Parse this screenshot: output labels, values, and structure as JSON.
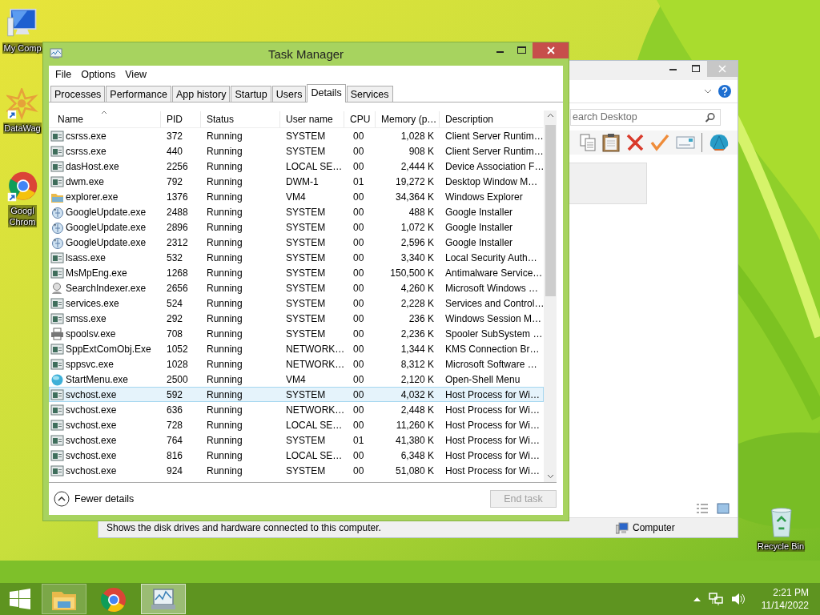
{
  "desktop_icons": [
    {
      "kind": "computer",
      "label": "My Comp"
    },
    {
      "kind": "datawag",
      "label": "DataWag"
    },
    {
      "kind": "chrome",
      "label": "Googl\nChrom"
    },
    {
      "kind": "recycle",
      "label": "Recycle Bin"
    }
  ],
  "explorer": {
    "search": {
      "placeholder": "earch Desktop"
    },
    "status_text": "Shows the disk drives and hardware connected to this computer.",
    "location": "Computer"
  },
  "task_manager": {
    "title": "Task Manager",
    "menu": [
      "File",
      "Options",
      "View"
    ],
    "tabs": [
      {
        "label": "Processes",
        "selected": false
      },
      {
        "label": "Performance",
        "selected": false
      },
      {
        "label": "App history",
        "selected": false
      },
      {
        "label": "Startup",
        "selected": false
      },
      {
        "label": "Users",
        "selected": false
      },
      {
        "label": "Details",
        "selected": true
      },
      {
        "label": "Services",
        "selected": false
      }
    ],
    "columns": [
      "Name",
      "PID",
      "Status",
      "User name",
      "CPU",
      "Memory (p…",
      "Description"
    ],
    "rows": [
      {
        "kind": "app",
        "name": "csrss.exe",
        "pid": "372",
        "status": "Running",
        "user": "SYSTEM",
        "cpu": "00",
        "memory": "1,028 K",
        "description": "Client Server Runtim…",
        "selected": false
      },
      {
        "kind": "app",
        "name": "csrss.exe",
        "pid": "440",
        "status": "Running",
        "user": "SYSTEM",
        "cpu": "00",
        "memory": "908 K",
        "description": "Client Server Runtim…",
        "selected": false
      },
      {
        "kind": "app",
        "name": "dasHost.exe",
        "pid": "2256",
        "status": "Running",
        "user": "LOCAL SE…",
        "cpu": "00",
        "memory": "2,444 K",
        "description": "Device Association F…",
        "selected": false
      },
      {
        "kind": "app",
        "name": "dwm.exe",
        "pid": "792",
        "status": "Running",
        "user": "DWM-1",
        "cpu": "01",
        "memory": "19,272 K",
        "description": "Desktop Window M…",
        "selected": false
      },
      {
        "kind": "folder",
        "name": "explorer.exe",
        "pid": "1376",
        "status": "Running",
        "user": "VM4",
        "cpu": "00",
        "memory": "34,364 K",
        "description": "Windows Explorer",
        "selected": false
      },
      {
        "kind": "update",
        "name": "GoogleUpdate.exe",
        "pid": "2488",
        "status": "Running",
        "user": "SYSTEM",
        "cpu": "00",
        "memory": "488 K",
        "description": "Google Installer",
        "selected": false
      },
      {
        "kind": "update",
        "name": "GoogleUpdate.exe",
        "pid": "2896",
        "status": "Running",
        "user": "SYSTEM",
        "cpu": "00",
        "memory": "1,072 K",
        "description": "Google Installer",
        "selected": false
      },
      {
        "kind": "update",
        "name": "GoogleUpdate.exe",
        "pid": "2312",
        "status": "Running",
        "user": "SYSTEM",
        "cpu": "00",
        "memory": "2,596 K",
        "description": "Google Installer",
        "selected": false
      },
      {
        "kind": "app",
        "name": "lsass.exe",
        "pid": "532",
        "status": "Running",
        "user": "SYSTEM",
        "cpu": "00",
        "memory": "3,340 K",
        "description": "Local Security Auth…",
        "selected": false
      },
      {
        "kind": "app",
        "name": "MsMpEng.exe",
        "pid": "1268",
        "status": "Running",
        "user": "SYSTEM",
        "cpu": "00",
        "memory": "150,500 K",
        "description": "Antimalware Service…",
        "selected": false
      },
      {
        "kind": "search",
        "name": "SearchIndexer.exe",
        "pid": "2656",
        "status": "Running",
        "user": "SYSTEM",
        "cpu": "00",
        "memory": "4,260 K",
        "description": "Microsoft Windows …",
        "selected": false
      },
      {
        "kind": "app",
        "name": "services.exe",
        "pid": "524",
        "status": "Running",
        "user": "SYSTEM",
        "cpu": "00",
        "memory": "2,228 K",
        "description": "Services and Control…",
        "selected": false
      },
      {
        "kind": "app",
        "name": "smss.exe",
        "pid": "292",
        "status": "Running",
        "user": "SYSTEM",
        "cpu": "00",
        "memory": "236 K",
        "description": "Windows Session M…",
        "selected": false
      },
      {
        "kind": "printer",
        "name": "spoolsv.exe",
        "pid": "708",
        "status": "Running",
        "user": "SYSTEM",
        "cpu": "00",
        "memory": "2,236 K",
        "description": "Spooler SubSystem …",
        "selected": false
      },
      {
        "kind": "app",
        "name": "SppExtComObj.Exe",
        "pid": "1052",
        "status": "Running",
        "user": "NETWORK…",
        "cpu": "00",
        "memory": "1,344 K",
        "description": "KMS Connection Br…",
        "selected": false
      },
      {
        "kind": "app",
        "name": "sppsvc.exe",
        "pid": "1028",
        "status": "Running",
        "user": "NETWORK…",
        "cpu": "00",
        "memory": "8,312 K",
        "description": "Microsoft Software …",
        "selected": false
      },
      {
        "kind": "shell",
        "name": "StartMenu.exe",
        "pid": "2500",
        "status": "Running",
        "user": "VM4",
        "cpu": "00",
        "memory": "2,120 K",
        "description": "Open-Shell Menu",
        "selected": false
      },
      {
        "kind": "app",
        "name": "svchost.exe",
        "pid": "592",
        "status": "Running",
        "user": "SYSTEM",
        "cpu": "00",
        "memory": "4,032 K",
        "description": "Host Process for Wi…",
        "selected": true
      },
      {
        "kind": "app",
        "name": "svchost.exe",
        "pid": "636",
        "status": "Running",
        "user": "NETWORK…",
        "cpu": "00",
        "memory": "2,448 K",
        "description": "Host Process for Wi…",
        "selected": false
      },
      {
        "kind": "app",
        "name": "svchost.exe",
        "pid": "728",
        "status": "Running",
        "user": "LOCAL SE…",
        "cpu": "00",
        "memory": "11,260 K",
        "description": "Host Process for Wi…",
        "selected": false
      },
      {
        "kind": "app",
        "name": "svchost.exe",
        "pid": "764",
        "status": "Running",
        "user": "SYSTEM",
        "cpu": "01",
        "memory": "41,380 K",
        "description": "Host Process for Wi…",
        "selected": false
      },
      {
        "kind": "app",
        "name": "svchost.exe",
        "pid": "816",
        "status": "Running",
        "user": "LOCAL SE…",
        "cpu": "00",
        "memory": "6,348 K",
        "description": "Host Process for Wi…",
        "selected": false
      },
      {
        "kind": "app",
        "name": "svchost.exe",
        "pid": "924",
        "status": "Running",
        "user": "SYSTEM",
        "cpu": "00",
        "memory": "51,080 K",
        "description": "Host Process for Wi…",
        "selected": false
      }
    ],
    "fewer_details": "Fewer details",
    "end_task": {
      "label": "End task",
      "disabled": true
    }
  },
  "taskbar": {
    "apps": [
      {
        "kind": "explorer",
        "running": true,
        "selected": false
      },
      {
        "kind": "chrome",
        "running": false,
        "selected": false
      },
      {
        "kind": "taskmgr",
        "running": true,
        "selected": true
      }
    ],
    "time": "2:21 PM",
    "date": "11/14/2022"
  }
}
